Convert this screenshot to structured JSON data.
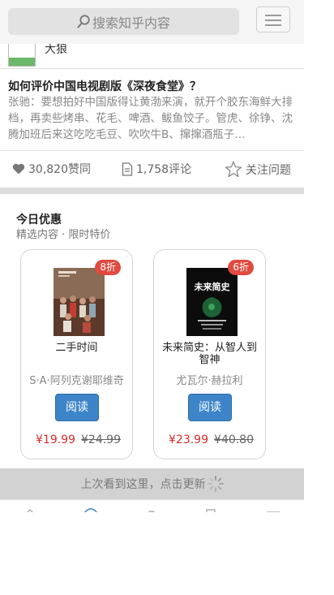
{
  "header": {
    "search_placeholder": "搜索知乎内容",
    "icons": {
      "search": "search-icon",
      "menu": "menu-icon"
    }
  },
  "feed": {
    "prev_author": "大狼",
    "question_title": "如何评价中国电视剧版《深夜食堂》？",
    "excerpt": "张驰：要想拍好中国版得让黄渤来演，就开个胶东海鲜大排档，再卖些烤串、花毛、啤酒、鲅鱼饺子。管虎、徐铮、沈腾加班后来这吃吃毛豆、吹吹牛B、撺撺酒瓶子…",
    "likes": "30,820赞同",
    "comments": "1,758评论",
    "follow": "关注问题"
  },
  "deals": {
    "title": "今日优惠",
    "subtitle": "精选内容 · 限时特价",
    "books": [
      {
        "title": "二手时间",
        "author": "S·A·阿列克谢耶维奇",
        "discount": "8折",
        "read_label": "阅读",
        "price": "¥19.99",
        "original_price": "¥24.99"
      },
      {
        "title": "未来简史：从智人到智神",
        "author": "尤瓦尔·赫拉利",
        "discount": "6折",
        "read_label": "阅读",
        "price": "¥23.99",
        "original_price": "¥40.80",
        "cover_text": "未来简史"
      }
    ]
  },
  "refresh_bar": {
    "label": "上次看到这里，点击更新"
  },
  "colors": {
    "accent_blue": "#3d85c8",
    "price_red": "#d92b2b",
    "badge_red": "#e04a3f"
  }
}
